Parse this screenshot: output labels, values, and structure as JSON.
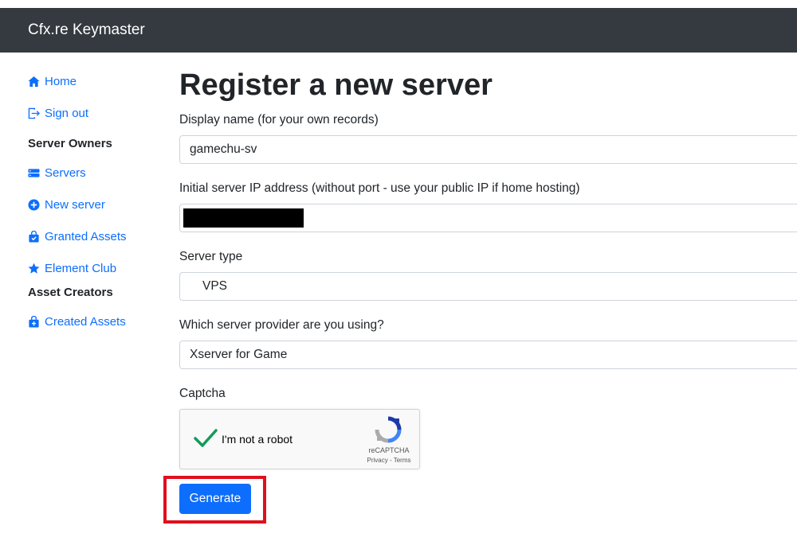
{
  "navbar": {
    "brand": "Cfx.re Keymaster"
  },
  "sidebar": {
    "items": [
      {
        "label": "Home",
        "icon": "home-icon"
      },
      {
        "label": "Sign out",
        "icon": "sign-out-icon"
      },
      {
        "heading": "Server Owners"
      },
      {
        "label": "Servers",
        "icon": "servers-icon"
      },
      {
        "label": "New server",
        "icon": "plus-circle-icon"
      },
      {
        "label": "Granted Assets",
        "icon": "bag-icon"
      },
      {
        "label": "Element Club",
        "icon": "star-icon"
      },
      {
        "heading": "Asset Creators"
      },
      {
        "label": "Created Assets",
        "icon": "bag-plus-icon"
      }
    ]
  },
  "form": {
    "title": "Register a new server",
    "display_name_label": "Display name (for your own records)",
    "display_name_value": "gamechu-sv",
    "ip_label": "Initial server IP address (without port - use your public IP if home hosting)",
    "ip_value": "",
    "server_type_label": "Server type",
    "server_type_value": "VPS",
    "provider_label": "Which server provider are you using?",
    "provider_value": "Xserver for Game",
    "captcha_label": "Captcha",
    "captcha": {
      "checkbox_text": "I'm not a robot",
      "brand": "reCAPTCHA",
      "privacy": "Privacy",
      "separator": " - ",
      "terms": "Terms",
      "checked": true
    },
    "submit_label": "Generate"
  },
  "colors": {
    "navbar_bg": "#343a40",
    "link": "#0d6efd",
    "button_bg": "#0d6efd",
    "highlight": "#e0101e",
    "check": "#0f9d58"
  }
}
